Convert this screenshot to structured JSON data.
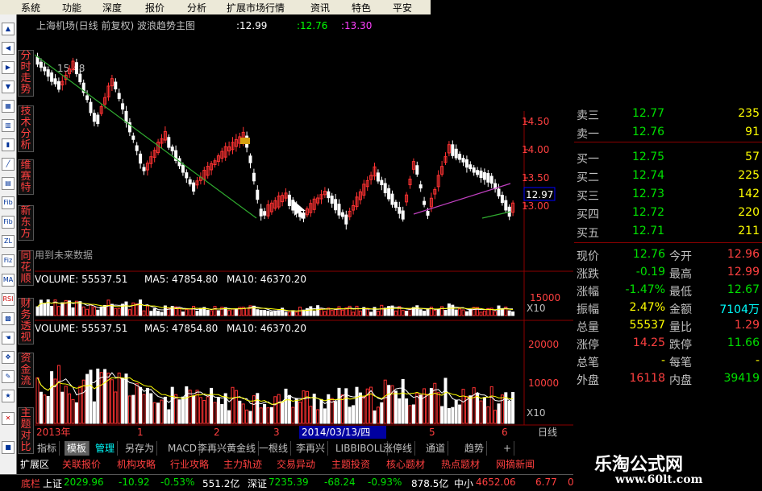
{
  "menubar": [
    "系统",
    "功能",
    "深度",
    "报价",
    "分析",
    "扩展市场行情",
    "资讯",
    "特色",
    "平安"
  ],
  "vtabs": [
    [
      "分",
      "时",
      "走",
      "势"
    ],
    [
      "技",
      "术",
      "分",
      "析"
    ],
    [
      "维",
      "赛",
      "特"
    ],
    [
      "新",
      "东",
      "方"
    ],
    [
      "同",
      "花",
      "顺"
    ],
    [
      "财",
      "务",
      "透",
      "视"
    ],
    [
      "资",
      "金",
      "流"
    ],
    [
      "主",
      "题",
      "对",
      "比"
    ]
  ],
  "icons": [
    "arrow-up",
    "arrow-left",
    "arrow-right",
    "arrow-down",
    "grid",
    "bar",
    "candle",
    "line",
    "kline",
    "Fib",
    "Fib2",
    "ZL",
    "Fiz",
    "MA",
    "RSI",
    "fill",
    "hand",
    "tool",
    "pen",
    "star",
    "exit"
  ],
  "chart": {
    "title": "上海机场(日线 前复权) 波浪趋势主图",
    "v1": ":12.99",
    "v2": ":12.76",
    "v3": ":13.30",
    "high_label": "15.48",
    "future_label": "用到未来数据",
    "price_ticks": [
      "14.50",
      "14.00",
      "13.50",
      "13.00"
    ],
    "current_price": "12.97",
    "vol1_header": {
      "volume": "VOLUME: 55537.51",
      "ma5": "MA5: 47854.80",
      "ma10": "MA10: 46370.20"
    },
    "vol1_ticks": [
      "15000"
    ],
    "vol1_unit": "X10",
    "vol2_header": {
      "volume": "VOLUME: 55537.51",
      "ma5": "MA5: 47854.80",
      "ma10": "MA10: 46370.20"
    },
    "vol2_ticks": [
      "20000",
      "10000"
    ],
    "vol2_unit": "X10",
    "period": "日线",
    "xaxis": {
      "year": "2013年",
      "m1": "1",
      "m2": "2",
      "m3": "3",
      "date": "2014/03/13/四",
      "m5": "5",
      "m6": "6"
    }
  },
  "quote": {
    "rows": [
      {
        "label": "卖三",
        "price": "12.77",
        "vol": "235"
      },
      {
        "label": "卖一",
        "price": "12.76",
        "vol": "91"
      },
      {
        "label": "买一",
        "price": "12.75",
        "vol": "57"
      },
      {
        "label": "买二",
        "price": "12.74",
        "vol": "225"
      },
      {
        "label": "买三",
        "price": "12.73",
        "vol": "142"
      },
      {
        "label": "买四",
        "price": "12.72",
        "vol": "220"
      },
      {
        "label": "买五",
        "price": "12.71",
        "vol": "211"
      }
    ],
    "stats": [
      {
        "l1": "现价",
        "v1": "12.76",
        "l2": "今开",
        "v2": "12.96"
      },
      {
        "l1": "涨跌",
        "v1": "-0.19",
        "l2": "最高",
        "v2": "12.99"
      },
      {
        "l1": "涨幅",
        "v1": "-1.47%",
        "l2": "最低",
        "v2": "12.67"
      },
      {
        "l1": "振幅",
        "v1": "2.47%",
        "l2": "金额",
        "v2": "7104万"
      },
      {
        "l1": "总量",
        "v1": "55537",
        "l2": "量比",
        "v2": "1.29"
      },
      {
        "l1": "涨停",
        "v1": "14.25",
        "l2": "跌停",
        "v2": "11.66"
      },
      {
        "l1": "总笔",
        "v1": "-",
        "l2": "每笔",
        "v2": "-"
      },
      {
        "l1": "外盘",
        "v1": "16118",
        "l2": "内盘",
        "v2": "39419"
      }
    ]
  },
  "tabs1": [
    "指标",
    "模板",
    "管理",
    "另存为",
    "MACD",
    "李再兴黄金线",
    "一根线",
    "李再兴",
    "LIBBIBOLL",
    "涨停线",
    "通道",
    "趋势",
    "+"
  ],
  "tabs2": [
    "扩展区",
    "关联报价",
    "机构攻略",
    "行业攻略",
    "主力轨迹",
    "交易异动",
    "主题投资",
    "核心题材",
    "热点题材",
    "网摘新闻"
  ],
  "status": {
    "label": "底栏",
    "sh_name": "上证",
    "sh_val": "2029.96",
    "sh_chg": "-10.92",
    "sh_pct": "-0.53%",
    "sh_amt": "551.2亿",
    "sz_name": "深证",
    "sz_val": "7235.39",
    "sz_chg": "-68.24",
    "sz_pct": "-0.93%",
    "sz_amt": "878.5亿",
    "zx_name": "中小",
    "zx_val": "4652.06",
    "zx_chg": "6.77",
    "zx_pct": "0.15%"
  },
  "watermark": {
    "title": "乐淘公式网",
    "url": "www.60lt.com"
  },
  "colors": {
    "up": "#ff3232",
    "down": "#ffffff",
    "ma5": "#ffffff",
    "ma10": "#ffff00",
    "trend": "#2faa2f",
    "trend2": "#c040c0",
    "label_red": "#ff4040",
    "value_green": "#00e000",
    "cyan": "#00ffff"
  }
}
